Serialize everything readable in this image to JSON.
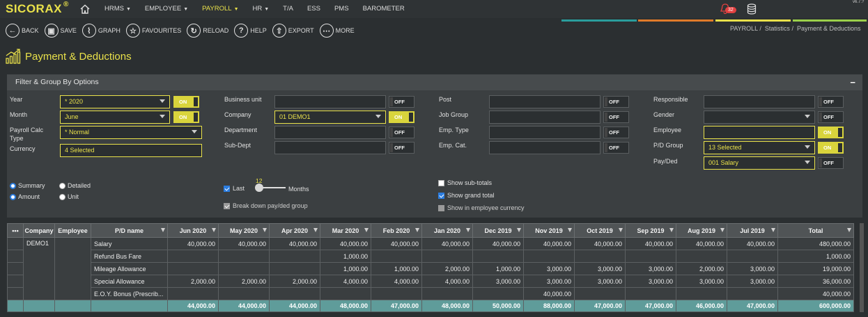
{
  "app": {
    "logo": "SICORAX",
    "reg": "®",
    "version": "v6.7.?"
  },
  "nav": [
    {
      "label": "HRMS",
      "caret": true,
      "active": false
    },
    {
      "label": "EMPLOYEE",
      "caret": true,
      "active": false
    },
    {
      "label": "PAYROLL",
      "caret": true,
      "active": true
    },
    {
      "label": "HR",
      "caret": true,
      "active": false
    },
    {
      "label": "T/A",
      "caret": false,
      "active": false
    },
    {
      "label": "ESS",
      "caret": false,
      "active": false
    },
    {
      "label": "PMS",
      "caret": false,
      "active": false
    },
    {
      "label": "BAROMETER",
      "caret": false,
      "active": false
    }
  ],
  "notifications": {
    "count": "32"
  },
  "toolbar": [
    {
      "label": "BACK",
      "icon": "back-icon",
      "glyph": "←"
    },
    {
      "label": "SAVE",
      "icon": "save-icon",
      "glyph": "▣"
    },
    {
      "label": "GRAPH",
      "icon": "graph-icon",
      "glyph": "⌇"
    },
    {
      "label": "FAVOURITES",
      "icon": "star-icon",
      "glyph": "☆"
    },
    {
      "label": "RELOAD",
      "icon": "reload-icon",
      "glyph": "↻"
    },
    {
      "label": "HELP",
      "icon": "help-icon",
      "glyph": "?"
    },
    {
      "label": "EXPORT",
      "icon": "export-icon",
      "glyph": "⇧"
    },
    {
      "label": "MORE",
      "icon": "more-icon",
      "glyph": "⋯"
    }
  ],
  "accent_bars": [
    "#2a9d9c",
    "#e07a2a",
    "#e9e14a",
    "#9bd04a"
  ],
  "breadcrumb": {
    "b1": "PAYROLL",
    "b2": "Statistics",
    "b3": "Payment & Deductions",
    "sep": "/"
  },
  "page": {
    "title": "Payment & Deductions"
  },
  "filter": {
    "title": "Filter & Group By Options",
    "year": {
      "label": "Year",
      "value": "*    2020",
      "toggle": "ON"
    },
    "month": {
      "label": "Month",
      "value": "June",
      "toggle": "ON"
    },
    "payroll_calc_type": {
      "label1": "Payroll Calc",
      "label2": "Type",
      "value": "*    Normal"
    },
    "currency": {
      "label": "Currency",
      "value": "4 Selected"
    },
    "business_unit": {
      "label": "Business unit",
      "value": "",
      "toggle": "OFF"
    },
    "company": {
      "label": "Company",
      "value": "01 DEMO1",
      "toggle": "ON"
    },
    "department": {
      "label": "Department",
      "value": "",
      "toggle": "OFF"
    },
    "sub_dept": {
      "label": "Sub-Dept",
      "value": "",
      "toggle": "OFF"
    },
    "post": {
      "label": "Post",
      "value": "",
      "toggle": "OFF"
    },
    "job_group": {
      "label": "Job Group",
      "value": "",
      "toggle": "OFF"
    },
    "emp_type": {
      "label": "Emp. Type",
      "value": "",
      "toggle": "OFF"
    },
    "emp_cat": {
      "label": "Emp. Cat.",
      "value": "",
      "toggle": "OFF"
    },
    "responsible": {
      "label": "Responsible",
      "value": "",
      "toggle": "OFF"
    },
    "gender": {
      "label": "Gender",
      "value": "",
      "toggle": "OFF"
    },
    "employee": {
      "label": "Employee",
      "value": "",
      "toggle": "ON"
    },
    "pd_group": {
      "label": "P/D Group",
      "value": "13 Selected",
      "toggle": "ON"
    },
    "pay_ded": {
      "label": "Pay/Ded",
      "value": "001 Salary",
      "toggle": "OFF"
    },
    "mode": {
      "summary": "Summary",
      "detailed": "Detailed",
      "amount": "Amount",
      "unit": "Unit"
    },
    "last": {
      "label": "Last",
      "value": "12",
      "unit": "Months"
    },
    "break_down": "Break down pay/ded group",
    "show_subtotals": "Show sub-totals",
    "show_grand_total": "Show grand total",
    "show_employee_currency": "Show in employee currency"
  },
  "table": {
    "headers": [
      "•••",
      "Company",
      "Employee",
      "P/D name",
      "Jun 2020",
      "May 2020",
      "Apr 2020",
      "Mar 2020",
      "Feb 2020",
      "Jan 2020",
      "Dec 2019",
      "Nov 2019",
      "Oct 2019",
      "Sep 2019",
      "Aug 2019",
      "Jul 2019",
      "Total"
    ],
    "company": "DEMO1",
    "rows": [
      {
        "name": "Salary",
        "values": [
          "40,000.00",
          "40,000.00",
          "40,000.00",
          "40,000.00",
          "40,000.00",
          "40,000.00",
          "40,000.00",
          "40,000.00",
          "40,000.00",
          "40,000.00",
          "40,000.00",
          "40,000.00",
          "480,000.00"
        ]
      },
      {
        "name": "Refund Bus Fare",
        "values": [
          "",
          "",
          "",
          "1,000.00",
          "",
          "",
          "",
          "",
          "",
          "",
          "",
          "",
          "1,000.00"
        ]
      },
      {
        "name": "Mileage Allowance",
        "values": [
          "",
          "",
          "",
          "1,000.00",
          "1,000.00",
          "2,000.00",
          "1,000.00",
          "3,000.00",
          "3,000.00",
          "3,000.00",
          "2,000.00",
          "3,000.00",
          "19,000.00"
        ]
      },
      {
        "name": "Special Allowance",
        "values": [
          "2,000.00",
          "2,000.00",
          "2,000.00",
          "4,000.00",
          "4,000.00",
          "4,000.00",
          "3,000.00",
          "3,000.00",
          "3,000.00",
          "3,000.00",
          "3,000.00",
          "3,000.00",
          "36,000.00"
        ]
      },
      {
        "name": "E.O.Y. Bonus (Prescrib...",
        "values": [
          "",
          "",
          "",
          "",
          "",
          "",
          "",
          "40,000.00",
          "",
          "",
          "",
          "",
          "40,000.00"
        ]
      }
    ],
    "totals": [
      "44,000.00",
      "44,000.00",
      "44,000.00",
      "48,000.00",
      "47,000.00",
      "48,000.00",
      "50,000.00",
      "88,000.00",
      "47,000.00",
      "47,000.00",
      "46,000.00",
      "47,000.00",
      "600,000.00"
    ]
  }
}
